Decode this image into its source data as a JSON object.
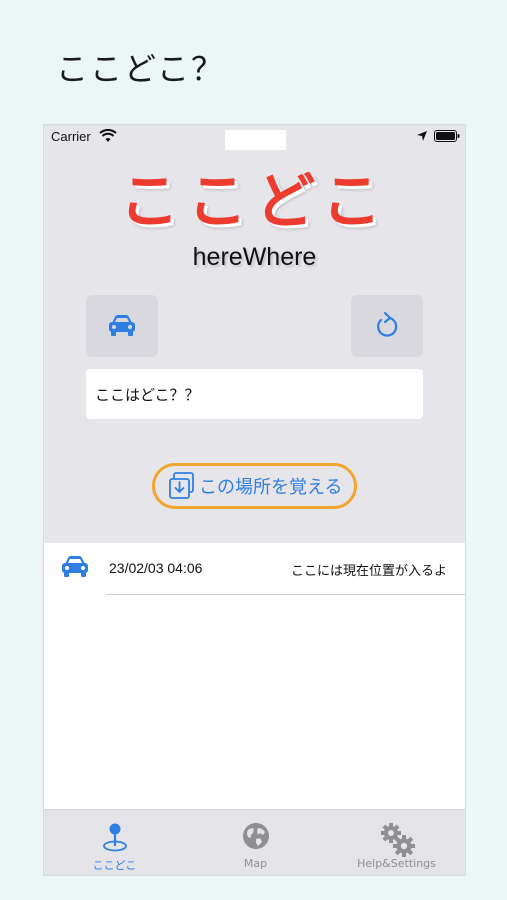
{
  "caption": "ここどこ？",
  "status_bar": {
    "carrier": "Carrier"
  },
  "app": {
    "title": "ここどこ",
    "subtitle": "hereWhere",
    "location_text": "ここはどこ？？",
    "remember_button": "この場所を覚える"
  },
  "history": [
    {
      "date": "23/02/03 04:06",
      "place": "ここには現在位置が入るよ"
    }
  ],
  "tabs": [
    {
      "label": "ここどこ",
      "icon": "map-pin-icon",
      "selected": true
    },
    {
      "label": "Map",
      "icon": "globe-icon",
      "selected": false
    },
    {
      "label": "Help&Settings",
      "icon": "gears-icon",
      "selected": false
    }
  ],
  "colors": {
    "accent": "#2f7fe3",
    "title_red": "#ee3b2f",
    "button_outline": "#f2a530",
    "background": "#ecf6f7"
  }
}
